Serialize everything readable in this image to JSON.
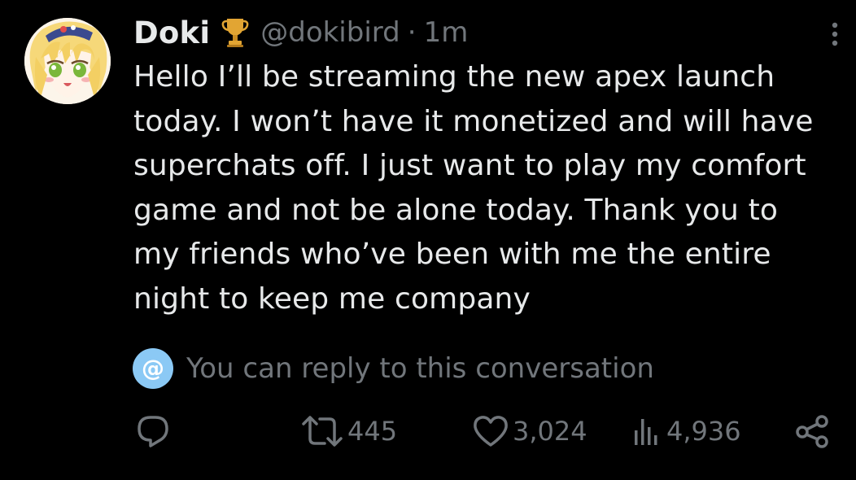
{
  "author": {
    "display_name": "Doki",
    "handle": "@dokibird",
    "separator": "·",
    "time_ago": "1m",
    "badge_icon": "trophy-icon",
    "avatar": "anime-avatar-blonde-girl"
  },
  "tweet": {
    "text": "Hello I’ll be streaming the new apex launch\ntoday. I won’t have it monetized and will have\nsuperchats off. I just want to play my comfort\ngame and not be alone today. Thank you to\nmy friends who’ve been with me the entire\nnight to keep me company"
  },
  "reply_notice": {
    "icon_glyph": "@",
    "text": "You can reply to this conversation",
    "icon_color": "#8bc9f5"
  },
  "actions": {
    "reply": {
      "icon": "reply-icon"
    },
    "retweet": {
      "icon": "retweet-icon",
      "count": "445"
    },
    "like": {
      "icon": "heart-icon",
      "count": "3,024"
    },
    "views": {
      "icon": "views-chart-icon",
      "count": "4,936"
    },
    "share": {
      "icon": "share-icon"
    }
  },
  "colors": {
    "background": "#000000",
    "primary_text": "#e7e9ea",
    "secondary_text": "#71767b",
    "trophy_gold": "#e2a533"
  }
}
